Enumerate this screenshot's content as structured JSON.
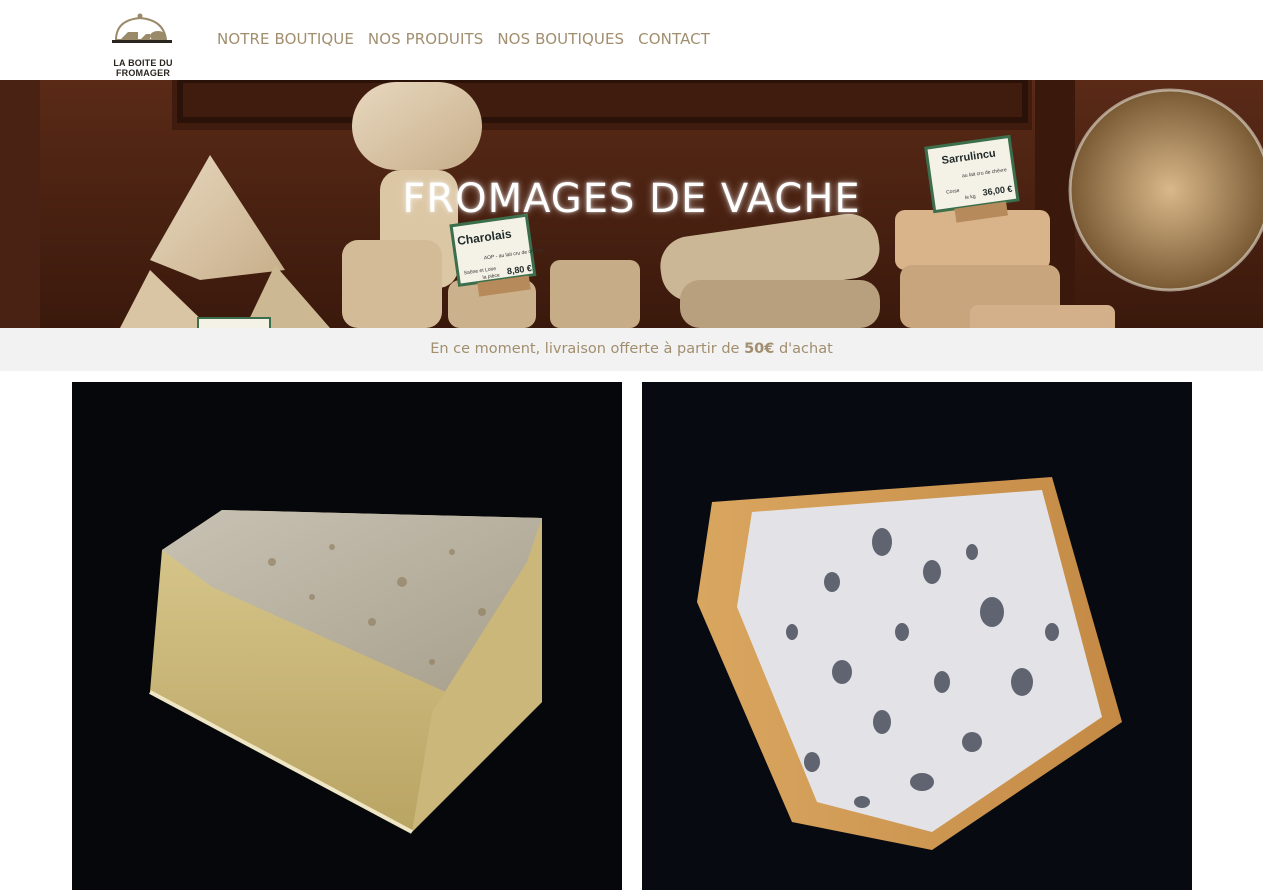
{
  "header": {
    "logo_text": "LA BOITE DU FROMAGER",
    "logo_icon": "cheese-dome-icon",
    "nav": [
      {
        "label": "NOTRE BOUTIQUE"
      },
      {
        "label": "NOS PRODUITS"
      },
      {
        "label": "NOS BOUTIQUES"
      },
      {
        "label": "CONTACT"
      }
    ]
  },
  "hero": {
    "title": "FROMAGES DE VACHE",
    "labels": [
      {
        "name": "Charolais",
        "line": "AOP - au lait cru de chèvre",
        "origin": "Saône et Loire",
        "price": "8,80 €",
        "unit": "la pièce"
      },
      {
        "name": "Sarrulincu",
        "line": "au lait cru de chèvre",
        "origin": "Corse",
        "price": "36,00 €",
        "unit": "le kg"
      }
    ]
  },
  "banner": {
    "prefix": "En ce moment, livraison offerte à partir de",
    "amount": "50€",
    "suffix": "d'achat"
  },
  "colors": {
    "accent": "#a18e6e",
    "banner_bg": "#f2f2f2",
    "product_bg": "#06070b"
  }
}
